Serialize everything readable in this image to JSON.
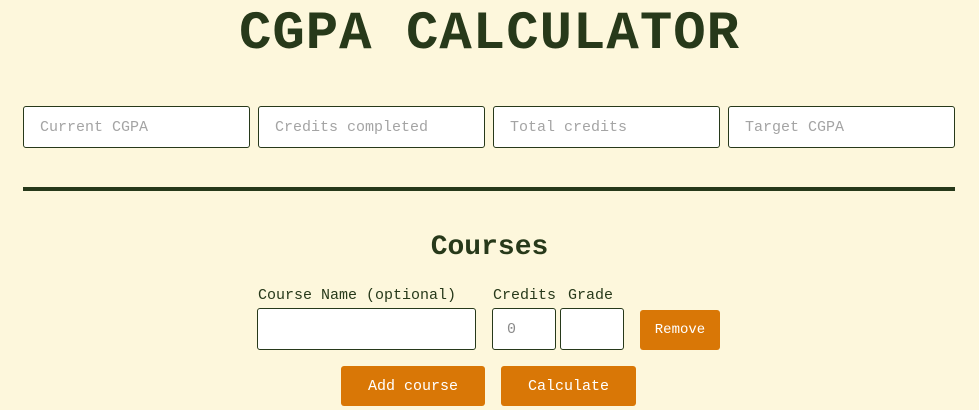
{
  "header": {
    "title": "CGPA CALCULATOR"
  },
  "summary_inputs": {
    "current_cgpa": {
      "placeholder": "Current CGPA",
      "value": ""
    },
    "credits_completed": {
      "placeholder": "Credits completed",
      "value": ""
    },
    "total_credits": {
      "placeholder": "Total credits",
      "value": ""
    },
    "target_cgpa": {
      "placeholder": "Target CGPA",
      "value": ""
    }
  },
  "courses": {
    "heading": "Courses",
    "columns": {
      "course_name": "Course Name (optional)",
      "credits": "Credits",
      "grade": "Grade"
    },
    "rows": [
      {
        "course_name": "",
        "credits_placeholder": "0",
        "grade": "",
        "remove_label": "Remove"
      }
    ]
  },
  "actions": {
    "add_course_label": "Add course",
    "calculate_label": "Calculate"
  },
  "colors": {
    "background": "#fdf7dc",
    "text": "#27391a",
    "accent": "#d97706"
  }
}
